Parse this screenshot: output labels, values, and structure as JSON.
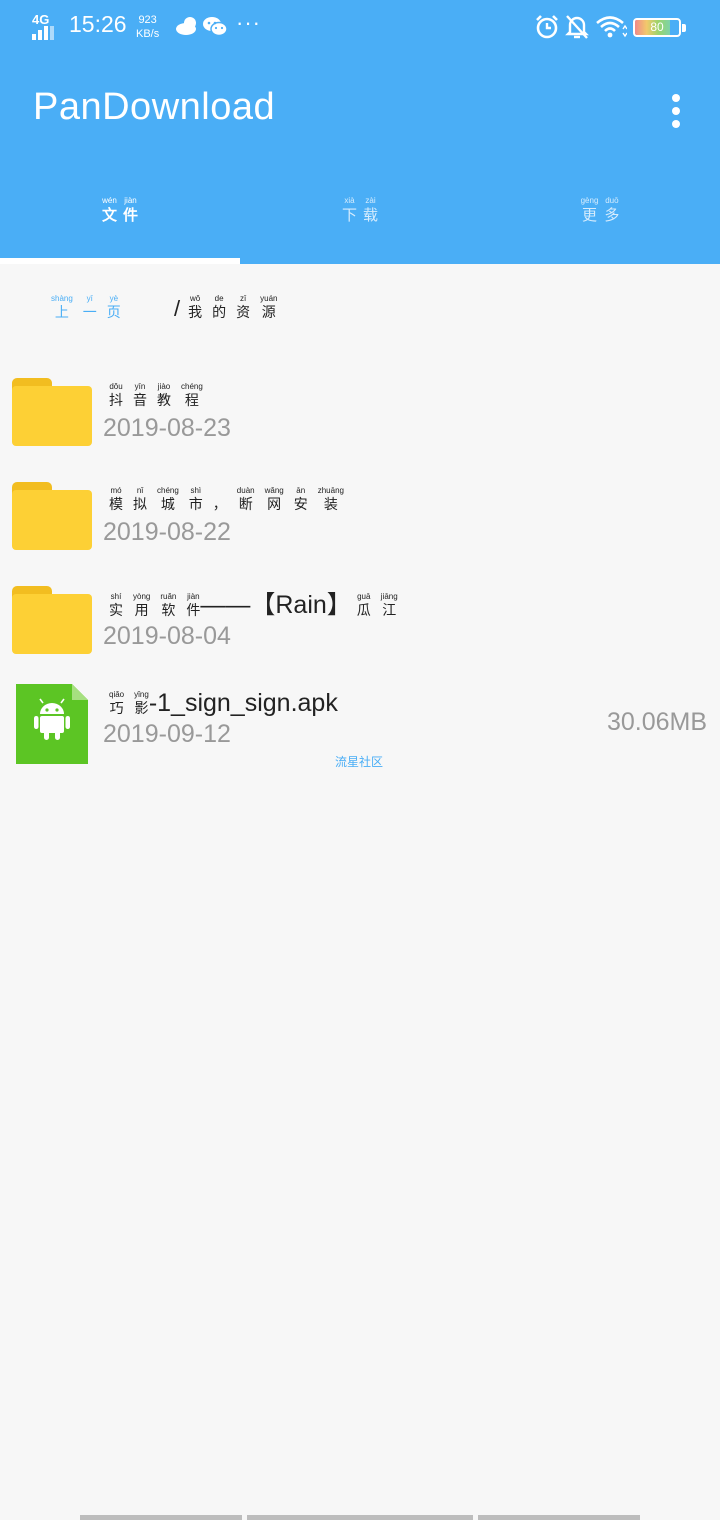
{
  "status_bar": {
    "network": "4G",
    "time": "15:26",
    "speed_value": "923",
    "speed_unit": "KB/s",
    "more": "···",
    "battery_level": "80"
  },
  "app_bar": {
    "title": "PanDownload"
  },
  "tabs": [
    {
      "chars": [
        {
          "py": "wén",
          "hz": "文"
        },
        {
          "py": "jiàn",
          "hz": "件"
        }
      ]
    },
    {
      "chars": [
        {
          "py": "xià",
          "hz": "下"
        },
        {
          "py": "zài",
          "hz": "载"
        }
      ]
    },
    {
      "chars": [
        {
          "py": "gèng",
          "hz": "更"
        },
        {
          "py": "duō",
          "hz": "多"
        }
      ]
    }
  ],
  "breadcrumb": {
    "back": [
      {
        "py": "shàng",
        "hz": "上"
      },
      {
        "py": "yī",
        "hz": "一"
      },
      {
        "py": "yè",
        "hz": "页"
      }
    ],
    "slash": "/",
    "path": [
      {
        "py": "wǒ",
        "hz": "我"
      },
      {
        "py": "de",
        "hz": "的"
      },
      {
        "py": "zī",
        "hz": "资"
      },
      {
        "py": "yuán",
        "hz": "源"
      }
    ]
  },
  "items": [
    {
      "name_ruby": [
        {
          "py": "dǒu",
          "hz": "抖"
        },
        {
          "py": "yīn",
          "hz": "音"
        },
        {
          "py": "jiào",
          "hz": "教"
        },
        {
          "py": "chéng",
          "hz": "程"
        }
      ],
      "date": "2019-08-23"
    },
    {
      "name_ruby": [
        {
          "py": "mó",
          "hz": "模"
        },
        {
          "py": "nǐ",
          "hz": "拟"
        },
        {
          "py": "chéng",
          "hz": "城"
        },
        {
          "py": "shì",
          "hz": "市"
        },
        {
          "py": "",
          "hz": "，"
        },
        {
          "py": "duàn",
          "hz": "断"
        },
        {
          "py": "wǎng",
          "hz": "网"
        },
        {
          "py": "ān",
          "hz": "安"
        },
        {
          "py": "zhuāng",
          "hz": "装"
        }
      ],
      "date": "2019-08-22"
    },
    {
      "name_ruby_a": [
        {
          "py": "shí",
          "hz": "实"
        },
        {
          "py": "yòng",
          "hz": "用"
        },
        {
          "py": "ruǎn",
          "hz": "软"
        },
        {
          "py": "jiàn",
          "hz": "件"
        }
      ],
      "name_latin": "——【Rain】",
      "name_ruby_b": [
        {
          "py": "guā",
          "hz": "瓜"
        },
        {
          "py": "jiāng",
          "hz": "江"
        }
      ],
      "date": "2019-08-04"
    },
    {
      "name_ruby": [
        {
          "py": "qiǎo",
          "hz": "巧"
        },
        {
          "py": "yǐng",
          "hz": "影"
        }
      ],
      "name_latin": "-1_sign_sign.apk",
      "date": "2019-09-12",
      "size": "30.06MB"
    }
  ],
  "watermark": "流星社区",
  "colors": {
    "primary": "#4aaef6",
    "folder": "#fdd035",
    "apk": "#5cc524",
    "text": "#222222",
    "secondary_text": "#999999"
  }
}
